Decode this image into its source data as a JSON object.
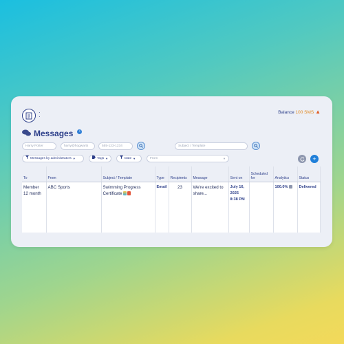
{
  "header": {
    "balance_label": "Balance",
    "balance_amount": "100 SMS"
  },
  "page": {
    "title": "Messages"
  },
  "filters": {
    "name_placeholder": "Harry Potter",
    "email_placeholder": "harry@hogwarts",
    "phone_placeholder": "555-123-1234",
    "subject_placeholder": "Subject / Template",
    "from_placeholder": "From"
  },
  "chips": {
    "messages_by": "Messages by administrators",
    "tags": "Tags",
    "date": "Date"
  },
  "table": {
    "headers": [
      "To",
      "From",
      "Subject / Template",
      "Type",
      "Recipients",
      "Message",
      "Sent on",
      "Scheduled for",
      "Analytics",
      "Status"
    ],
    "row": {
      "to": "Member 12 month",
      "from": "ABC Sports",
      "subject": "Swimming Progress Certificate",
      "type": "Email",
      "recipients": "23",
      "message": "We're excited to share...",
      "sent_on": "July 16, 2025 8:38 PM",
      "scheduled_for": "",
      "analytics": "100.0%",
      "status": "Delivered"
    }
  },
  "colors": {
    "accent": "#2d3f8a",
    "balance": "#e28a22",
    "primary_button": "#1f7fd9"
  }
}
